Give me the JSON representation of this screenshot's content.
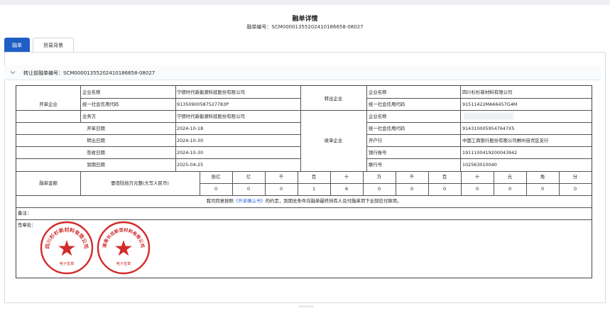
{
  "page": {
    "title": "融单详情",
    "subtitle_label": "融单编号：",
    "subtitle_value": "SCM0000135520241018665​8-08027"
  },
  "tabs": [
    {
      "label": "融单",
      "active": true
    },
    {
      "label": "贸易背景",
      "active": false
    }
  ],
  "section": {
    "label": "转让前融单编号：SCM00001355202410186658-08027"
  },
  "form": {
    "issuer": {
      "group_label": "开单企业",
      "company_name_label": "企业名称",
      "company_name": "宁德时代新能源科技股份有限公司",
      "credit_code_label": "统一社会信用代码",
      "credit_code": "91350900587527783P",
      "business_party_label": "业务方",
      "business_party": "宁德时代新能源科技股份有限公司"
    },
    "dates": [
      {
        "label": "开单日期",
        "value": "2024-10-18"
      },
      {
        "label": "转出日期",
        "value": "2024-10-30"
      },
      {
        "label": "签收日期",
        "value": "2024-10-30"
      },
      {
        "label": "到期日期",
        "value": "2025-04-25"
      }
    ],
    "transferor": {
      "group_label": "转出企业",
      "company_name_label": "企业名称",
      "company_name": "四川杉杉新材料有限公司",
      "credit_code_label": "统一社会信用代码",
      "credit_code": "91511422MA66457G4M"
    },
    "receiver": {
      "group_label": "收单企业",
      "company_name_label": "企业名称",
      "company_name": "",
      "credit_code_label": "统一社会信用代码",
      "credit_code": "91431000595476​47X5",
      "bank_label": "开户行",
      "bank": "中国工商银行股份有限公司郴州自贸区支行",
      "account_label": "银行账号",
      "account": "1911100419200043942",
      "interbank_label": "联行号",
      "interbank": "102563010040"
    },
    "amount": {
      "label": "融单金额",
      "text": "壹佰陆拾万元整(大写人民币)",
      "units": [
        "拾亿",
        "亿",
        "千",
        "百",
        "十",
        "万",
        "千",
        "百",
        "十",
        "元",
        "角",
        "分"
      ],
      "digits": [
        "0",
        "0",
        "0",
        "1",
        "6",
        "0",
        "0",
        "0",
        "0",
        "0",
        "0",
        "0"
      ]
    },
    "agreement": {
      "prefix": "我司同意按照",
      "link": "《开单确认书》",
      "suffix": "的约定，到期无条件向融单最终持有人兑付融单项下全部应付款项。"
    },
    "remark_label": "备注：",
    "signature_label": "签章处："
  },
  "stamps": [
    {
      "org": "四川杉杉新材料有限公司",
      "caption": "电子签章",
      "color": "#d42a2a"
    },
    {
      "org": "湖南长远新型材料有限公司",
      "caption": "电子签章",
      "color": "#d42a2a"
    }
  ]
}
